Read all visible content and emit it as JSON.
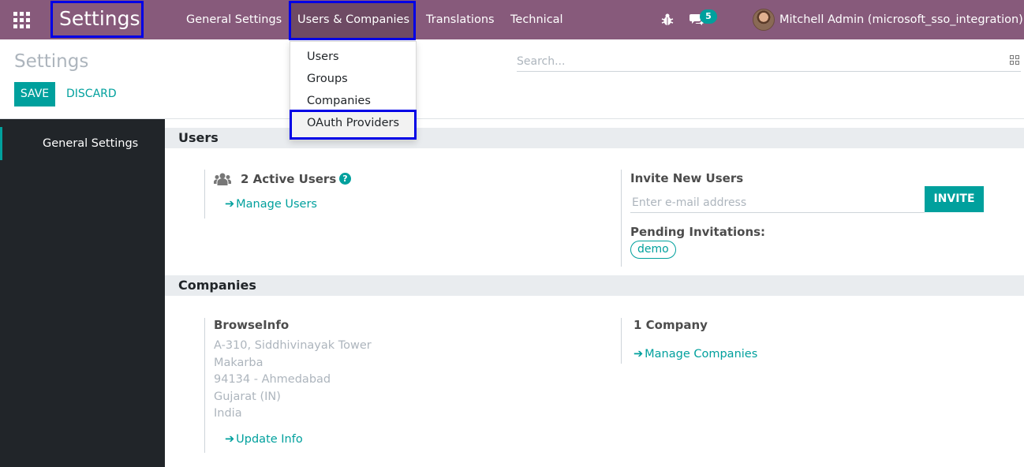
{
  "navbar": {
    "apps_icon": "apps-grid-icon",
    "brand": "Settings",
    "menu": [
      "General Settings",
      "Users & Companies",
      "Translations",
      "Technical"
    ],
    "debug_icon": "bug-icon",
    "chat_icon": "chat-icon",
    "chat_count": "5",
    "user_name": "Mitchell Admin (microsoft_sso_integration)"
  },
  "dropdown": {
    "items": [
      "Users",
      "Groups",
      "Companies",
      "OAuth Providers"
    ]
  },
  "control_panel": {
    "title": "Settings",
    "save_label": "SAVE",
    "discard_label": "DISCARD",
    "search_placeholder": "Search..."
  },
  "sidebar": {
    "items": [
      {
        "label": "General Settings"
      }
    ]
  },
  "users_section": {
    "header": "Users",
    "active_users": "2 Active Users",
    "help_glyph": "?",
    "manage_users_link": "Manage Users",
    "invite_label": "Invite New Users",
    "email_placeholder": "Enter e-mail address",
    "invite_button": "INVITE",
    "pending_label": "Pending Invitations:",
    "pending_tags": [
      "demo"
    ]
  },
  "companies_section": {
    "header": "Companies",
    "company_name": "BrowseInfo",
    "address_lines": [
      "A-310, Siddhivinayak Tower",
      "Makarba",
      "94134 - Ahmedabad",
      "Gujarat (IN)",
      "India"
    ],
    "update_info_link": "Update Info",
    "company_count": "1 Company",
    "manage_companies_link": "Manage Companies"
  },
  "colors": {
    "navbar": "#875a7b",
    "accent": "#00a09d",
    "sidebar": "#212529",
    "highlight_box": "#0000e6"
  }
}
